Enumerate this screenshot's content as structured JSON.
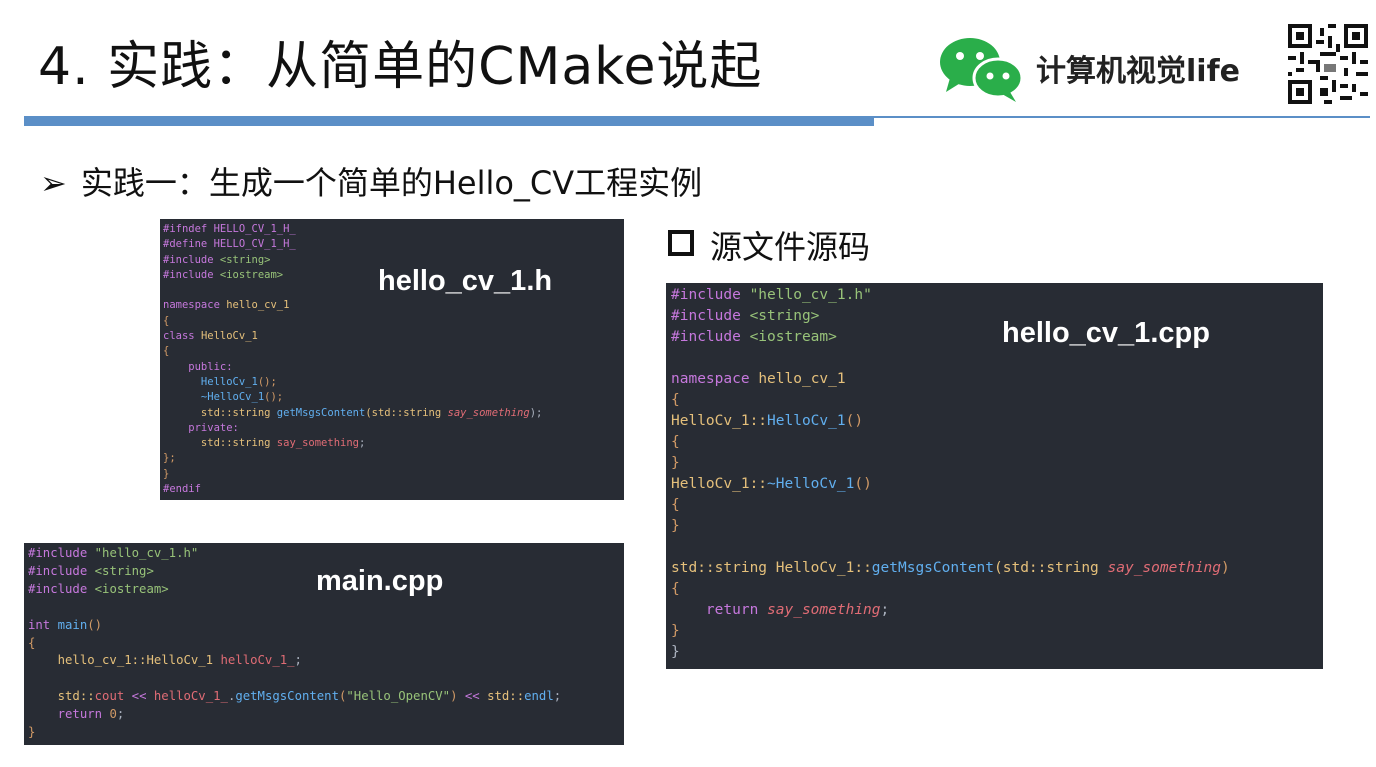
{
  "title": "4. 实践：从简单的CMake说起",
  "brand": {
    "name": "计算机视觉life",
    "logo_icon": "wechat-icon",
    "qr_icon": "qr-code-icon"
  },
  "bullet": {
    "marker": "➢",
    "text": "实践一：生成一个简单的Hello_CV工程实例"
  },
  "section": {
    "marker": "square-checkbox-icon",
    "text": "源文件源码"
  },
  "files": {
    "header": {
      "name": "hello_cv_1.h"
    },
    "cpp": {
      "name": "hello_cv_1.cpp"
    },
    "main": {
      "name": "main.cpp"
    }
  },
  "code_header": [
    [
      [
        "#ifndef HELLO_CV_1_H_",
        "pp"
      ]
    ],
    [
      [
        "#define HELLO_CV_1_H_",
        "pp"
      ]
    ],
    [
      [
        "#include ",
        "pp"
      ],
      [
        "<string>",
        "str"
      ]
    ],
    [
      [
        "#include ",
        "pp"
      ],
      [
        "<iostream>",
        "str"
      ]
    ],
    [],
    [
      [
        "namespace ",
        "kw"
      ],
      [
        "hello_cv_1",
        "ty"
      ]
    ],
    [
      [
        "{",
        "br"
      ]
    ],
    [
      [
        "class ",
        "kw"
      ],
      [
        "HelloCv_1",
        "ty"
      ]
    ],
    [
      [
        "{",
        "br"
      ]
    ],
    [
      [
        "    public:",
        "kw"
      ]
    ],
    [
      [
        "      HelloCv_1",
        "fn"
      ],
      [
        "();",
        "br"
      ]
    ],
    [
      [
        "      ~HelloCv_1",
        "fn"
      ],
      [
        "();",
        "br"
      ]
    ],
    [
      [
        "      std::string ",
        "ty"
      ],
      [
        "getMsgsContent",
        "fn"
      ],
      [
        "(std::string ",
        "ty"
      ],
      [
        "say_something",
        "par"
      ],
      [
        ");",
        "plain"
      ]
    ],
    [
      [
        "    private:",
        "kw"
      ]
    ],
    [
      [
        "      std::string ",
        "ty"
      ],
      [
        "say_something",
        "var"
      ],
      [
        ";",
        "plain"
      ]
    ],
    [
      [
        "};",
        "br"
      ]
    ],
    [
      [
        "}",
        "br"
      ]
    ],
    [
      [
        "#endif",
        "pp"
      ]
    ]
  ],
  "code_main": [
    [
      [
        "#include ",
        "pp"
      ],
      [
        "\"hello_cv_1.h\"",
        "str"
      ]
    ],
    [
      [
        "#include ",
        "pp"
      ],
      [
        "<string>",
        "str"
      ]
    ],
    [
      [
        "#include ",
        "pp"
      ],
      [
        "<iostream>",
        "str"
      ]
    ],
    [],
    [
      [
        "int ",
        "kw"
      ],
      [
        "main",
        "fn"
      ],
      [
        "()",
        "br"
      ]
    ],
    [
      [
        "{",
        "br"
      ]
    ],
    [
      [
        "    hello_cv_1::HelloCv_1 ",
        "ty"
      ],
      [
        "helloCv_1_",
        "var"
      ],
      [
        ";",
        "plain"
      ]
    ],
    [],
    [
      [
        "    std::",
        "ty"
      ],
      [
        "cout",
        "var"
      ],
      [
        " << ",
        "kw"
      ],
      [
        "helloCv_1_",
        "var"
      ],
      [
        ".",
        "plain"
      ],
      [
        "getMsgsContent",
        "fn"
      ],
      [
        "(",
        "br"
      ],
      [
        "\"Hello_OpenCV\"",
        "str"
      ],
      [
        ")",
        "br"
      ],
      [
        " << ",
        "kw"
      ],
      [
        "std::",
        "ty"
      ],
      [
        "endl",
        "fn"
      ],
      [
        ";",
        "plain"
      ]
    ],
    [
      [
        "    return ",
        "kw"
      ],
      [
        "0",
        "num"
      ],
      [
        ";",
        "plain"
      ]
    ],
    [
      [
        "}",
        "br"
      ]
    ]
  ],
  "code_cpp": [
    [
      [
        "#include ",
        "pp"
      ],
      [
        "\"hello_cv_1.h\"",
        "str"
      ]
    ],
    [
      [
        "#include ",
        "pp"
      ],
      [
        "<string>",
        "str"
      ]
    ],
    [
      [
        "#include ",
        "pp"
      ],
      [
        "<iostream>",
        "str"
      ]
    ],
    [],
    [
      [
        "namespace ",
        "kw"
      ],
      [
        "hello_cv_1",
        "ty"
      ]
    ],
    [
      [
        "{",
        "br"
      ]
    ],
    [
      [
        "HelloCv_1::",
        "ty"
      ],
      [
        "HelloCv_1",
        "fn"
      ],
      [
        "()",
        "br"
      ]
    ],
    [
      [
        "{",
        "br"
      ]
    ],
    [
      [
        "}",
        "br"
      ]
    ],
    [
      [
        "HelloCv_1::",
        "ty"
      ],
      [
        "~HelloCv_1",
        "fn"
      ],
      [
        "()",
        "br"
      ]
    ],
    [
      [
        "{",
        "br"
      ]
    ],
    [
      [
        "}",
        "br"
      ]
    ],
    [],
    [
      [
        "std::string ",
        "ty"
      ],
      [
        "HelloCv_1::",
        "ty"
      ],
      [
        "getMsgsContent",
        "fn"
      ],
      [
        "(std::string ",
        "ty"
      ],
      [
        "say_something",
        "par"
      ],
      [
        ")",
        "br"
      ]
    ],
    [
      [
        "{",
        "br"
      ]
    ],
    [
      [
        "    return ",
        "kw"
      ],
      [
        "say_something",
        "par"
      ],
      [
        ";",
        "plain"
      ]
    ],
    [
      [
        "}",
        "br"
      ]
    ],
    [
      [
        "}",
        "plain"
      ]
    ]
  ]
}
